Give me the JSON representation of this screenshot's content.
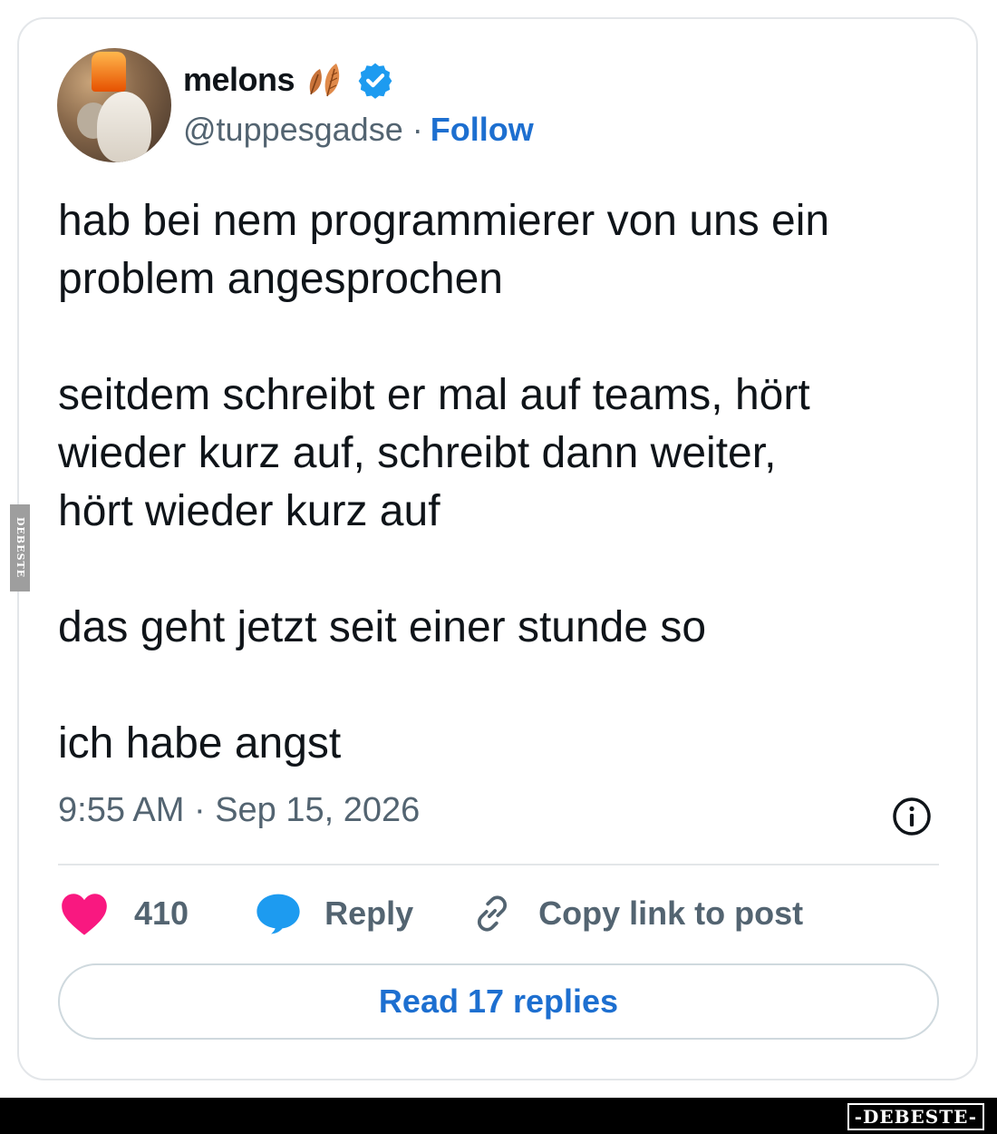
{
  "author": {
    "name": "melons",
    "handle": "@tuppesgadse",
    "separator": "·",
    "follow_label": "Follow"
  },
  "tweet": {
    "text": "hab bei nem programmierer von uns ein\nproblem angesprochen\n\nseitdem schreibt er mal auf teams, hört\nwieder kurz auf, schreibt dann weiter,\nhört wieder kurz auf\n\ndas geht jetzt seit einer stunde so\n\nich habe angst",
    "timestamp": "9:55 AM · Sep 15, 2026"
  },
  "actions": {
    "like_count": "410",
    "reply_label": "Reply",
    "copy_link_label": "Copy link to post"
  },
  "read_replies_label": "Read 17 replies",
  "watermark": {
    "side_text": "DEBESTE",
    "footer_text": "-DEBESTE-"
  },
  "icons": {
    "leaf": "leaf-icon",
    "verified": "verified-badge-icon",
    "info": "info-icon",
    "heart": "heart-icon",
    "reply": "reply-bubble-icon",
    "link": "link-icon"
  },
  "colors": {
    "accent": "#1d6fd0",
    "heart": "#f91880",
    "muted": "#536471",
    "text": "#0f1419",
    "border": "#e3e6e9"
  }
}
